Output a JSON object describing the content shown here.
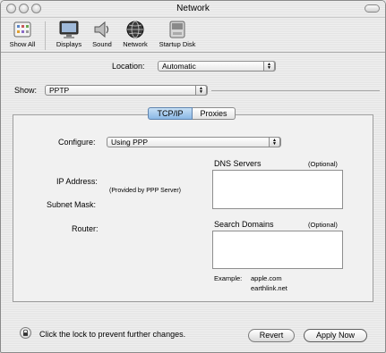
{
  "window": {
    "title": "Network"
  },
  "toolbar": {
    "items": [
      {
        "label": "Show All",
        "icon": "show-all-icon"
      },
      {
        "label": "Displays",
        "icon": "displays-icon"
      },
      {
        "label": "Sound",
        "icon": "sound-icon"
      },
      {
        "label": "Network",
        "icon": "network-icon"
      },
      {
        "label": "Startup Disk",
        "icon": "startup-disk-icon"
      }
    ]
  },
  "location": {
    "label": "Location:",
    "value": "Automatic"
  },
  "show": {
    "label": "Show:",
    "value": "PPTP"
  },
  "tabs": [
    {
      "label": "TCP/IP",
      "selected": true
    },
    {
      "label": "Proxies",
      "selected": false
    }
  ],
  "configure": {
    "label": "Configure:",
    "value": "Using PPP"
  },
  "fields": {
    "ip_address": "IP Address:",
    "provided_by": "(Provided by PPP Server)",
    "subnet_mask": "Subnet Mask:",
    "router": "Router:"
  },
  "dns": {
    "label": "DNS Servers",
    "optional": "(Optional)"
  },
  "search_domains": {
    "label": "Search Domains",
    "optional": "(Optional)"
  },
  "example": {
    "label": "Example:",
    "line1": "apple.com",
    "line2": "earthlink.net"
  },
  "footer": {
    "lock_text": "Click the lock to prevent further changes.",
    "revert": "Revert",
    "apply": "Apply Now"
  },
  "colors": {
    "tab_selected": "#8bb8e6",
    "window_bg": "#ececec"
  }
}
